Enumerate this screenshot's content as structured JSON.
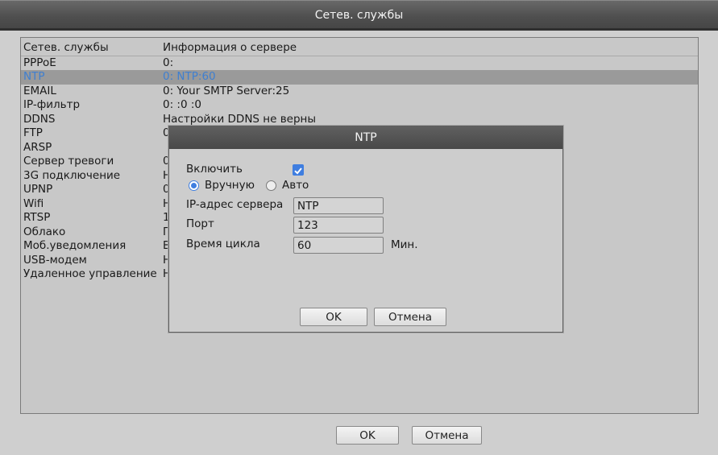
{
  "window": {
    "title": "Сетев. службы"
  },
  "table": {
    "headers": [
      "Сетев. службы",
      "Информация о сервере"
    ],
    "rows": [
      {
        "name": "PPPoE",
        "info": "0:"
      },
      {
        "name": "NTP",
        "info": "0: NTP:60"
      },
      {
        "name": "EMAIL",
        "info": "0: Your SMTP Server:25"
      },
      {
        "name": "IP-фильтр",
        "info": "0: :0 :0"
      },
      {
        "name": "DDNS",
        "info": "Настройки DDNS не верны"
      },
      {
        "name": "FTP",
        "info": "0"
      },
      {
        "name": "ARSP",
        "info": ""
      },
      {
        "name": "Сервер тревоги",
        "info": "0"
      },
      {
        "name": "3G подключение",
        "info": "Н"
      },
      {
        "name": "UPNP",
        "info": "0"
      },
      {
        "name": "Wifi",
        "info": "Н"
      },
      {
        "name": "RTSP",
        "info": "1"
      },
      {
        "name": "Облако",
        "info": "П"
      },
      {
        "name": "Моб.уведомления",
        "info": "В"
      },
      {
        "name": "USB-модем",
        "info": "Н"
      },
      {
        "name": "Удаленное управление",
        "info": "Н"
      }
    ],
    "selected_index": 1
  },
  "footer": {
    "ok_label": "OK",
    "cancel_label": "Отмена"
  },
  "ntp_dialog": {
    "title": "NTP",
    "enable_label": "Включить",
    "enable_checked": true,
    "mode_manual_label": "Вручную",
    "mode_auto_label": "Авто",
    "mode_selected": "manual",
    "server_label": "IP-адрес сервера",
    "server_value": "NTP",
    "port_label": "Порт",
    "port_value": "123",
    "cycle_label": "Время цикла",
    "cycle_value": "60",
    "cycle_unit": "Мин.",
    "ok_label": "OK",
    "cancel_label": "Отмена"
  },
  "colors": {
    "selected_text": "#3f7fd0",
    "checkbox_accent": "#3f7ee0",
    "title_bar": "#505050"
  }
}
